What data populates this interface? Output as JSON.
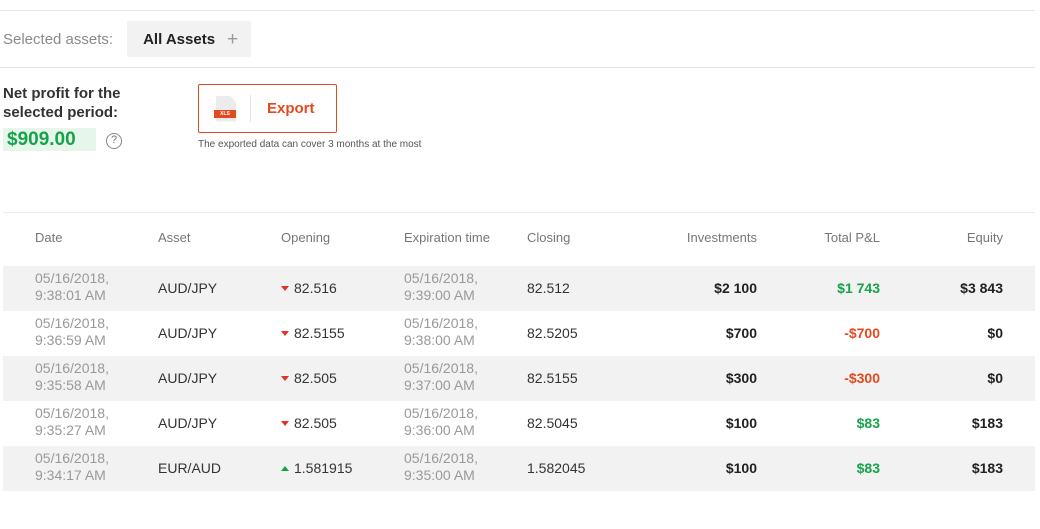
{
  "filter": {
    "label": "Selected assets:",
    "chip_label": "All Assets",
    "plus_icon": "+"
  },
  "summary": {
    "title": "Net profit for the selected period:",
    "value": "$909.00",
    "help_icon": "?"
  },
  "export": {
    "label": "Export",
    "file_badge": "XLS",
    "note": "The exported data can cover 3 months at the most"
  },
  "colors": {
    "accent": "#e34a1f",
    "profit_green": "#16a34a",
    "loss_red": "#e34a1f"
  },
  "table": {
    "headers": {
      "date": "Date",
      "asset": "Asset",
      "opening": "Opening",
      "expiration": "Expiration time",
      "closing": "Closing",
      "investments": "Investments",
      "total_pl": "Total P&L",
      "equity": "Equity"
    },
    "rows": [
      {
        "date": "05/16/2018,",
        "time": "9:38:01 AM",
        "asset": "AUD/JPY",
        "direction": "down",
        "opening": "82.516",
        "exp_date": "05/16/2018,",
        "exp_time": "9:39:00 AM",
        "closing": "82.512",
        "investments": "$2 100",
        "total_pl": "$1 743",
        "pl_sign": "positive",
        "equity": "$3 843"
      },
      {
        "date": "05/16/2018,",
        "time": "9:36:59 AM",
        "asset": "AUD/JPY",
        "direction": "down",
        "opening": "82.5155",
        "exp_date": "05/16/2018,",
        "exp_time": "9:38:00 AM",
        "closing": "82.5205",
        "investments": "$700",
        "total_pl": "-$700",
        "pl_sign": "negative",
        "equity": "$0"
      },
      {
        "date": "05/16/2018,",
        "time": "9:35:58 AM",
        "asset": "AUD/JPY",
        "direction": "down",
        "opening": "82.505",
        "exp_date": "05/16/2018,",
        "exp_time": "9:37:00 AM",
        "closing": "82.5155",
        "investments": "$300",
        "total_pl": "-$300",
        "pl_sign": "negative",
        "equity": "$0"
      },
      {
        "date": "05/16/2018,",
        "time": "9:35:27 AM",
        "asset": "AUD/JPY",
        "direction": "down",
        "opening": "82.505",
        "exp_date": "05/16/2018,",
        "exp_time": "9:36:00 AM",
        "closing": "82.5045",
        "investments": "$100",
        "total_pl": "$83",
        "pl_sign": "positive",
        "equity": "$183"
      },
      {
        "date": "05/16/2018,",
        "time": "9:34:17 AM",
        "asset": "EUR/AUD",
        "direction": "up",
        "opening": "1.581915",
        "exp_date": "05/16/2018,",
        "exp_time": "9:35:00 AM",
        "closing": "1.582045",
        "investments": "$100",
        "total_pl": "$83",
        "pl_sign": "positive",
        "equity": "$183"
      }
    ]
  }
}
